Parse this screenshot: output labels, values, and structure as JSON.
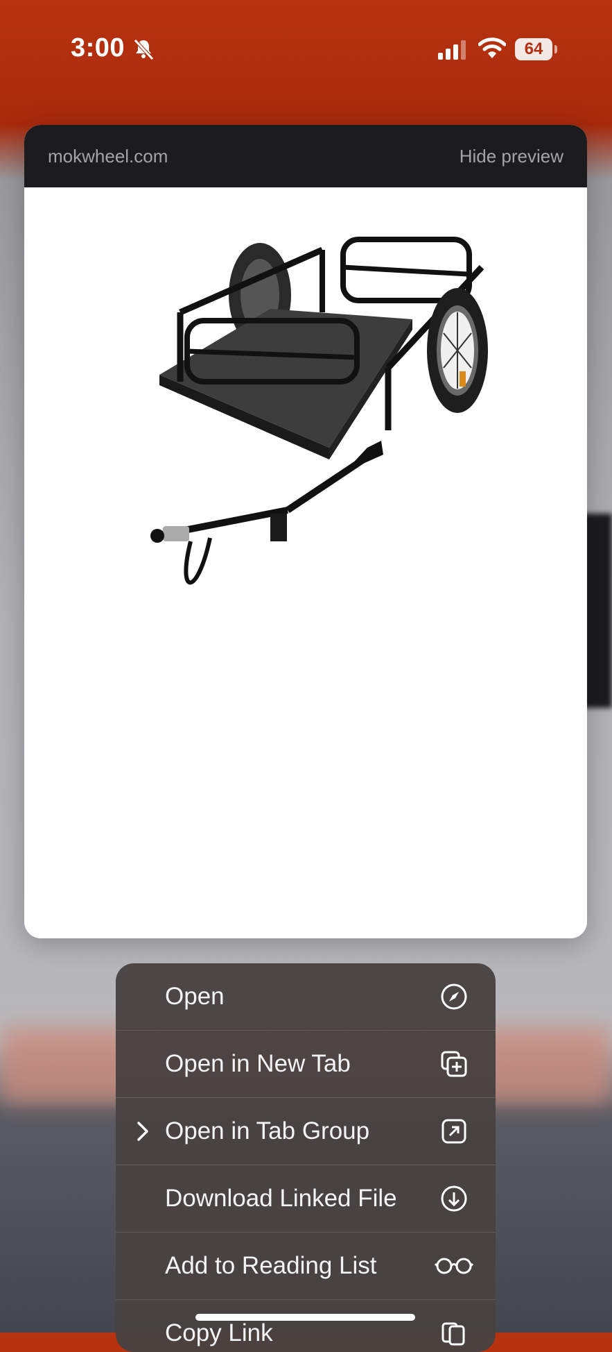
{
  "status_bar": {
    "time": "3:00",
    "battery": "64"
  },
  "preview": {
    "domain": "mokwheel.com",
    "hide_label": "Hide preview"
  },
  "menu": {
    "items": [
      {
        "label": "Open",
        "icon": "compass-icon"
      },
      {
        "label": "Open in New Tab",
        "icon": "new-tab-icon"
      },
      {
        "label": "Open in Tab Group",
        "icon": "tab-group-icon",
        "has_submenu": true
      },
      {
        "label": "Download Linked File",
        "icon": "download-icon"
      },
      {
        "label": "Add to Reading List",
        "icon": "glasses-icon"
      },
      {
        "label": "Copy Link",
        "icon": "copy-icon"
      }
    ]
  }
}
